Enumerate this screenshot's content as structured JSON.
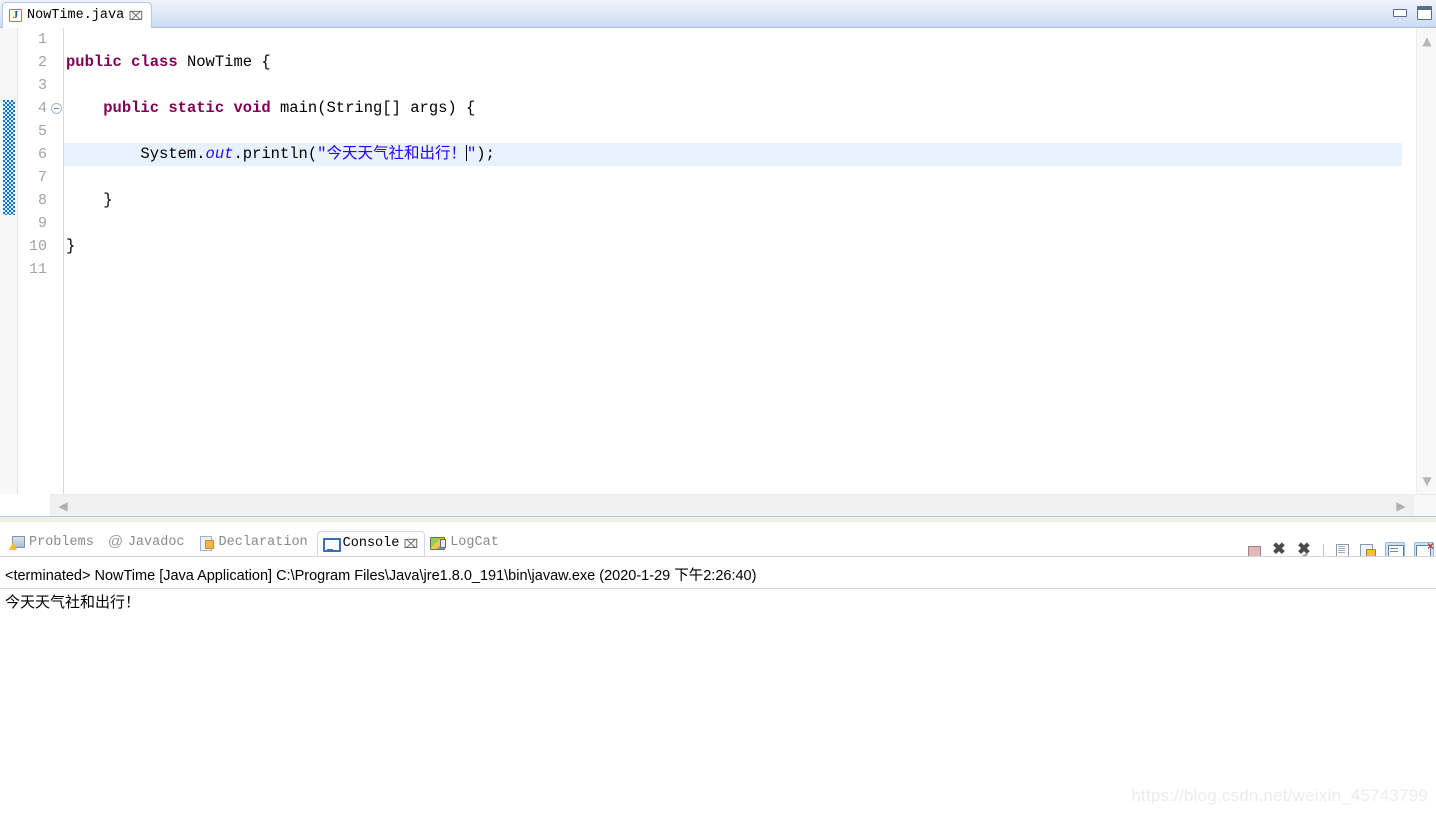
{
  "window": {
    "minimize_label": "Minimize",
    "maximize_label": "Maximize"
  },
  "editor": {
    "tab": {
      "label": "NowTime.java",
      "icon": "java-file-icon",
      "close_label": "⌧"
    },
    "line_numbers": [
      "1",
      "2",
      "3",
      "4",
      "5",
      "6",
      "7",
      "8",
      "9",
      "10",
      "11"
    ],
    "highlighted_line": 6,
    "folding_marker_line": 4,
    "lines": [
      {
        "n": "1",
        "segments": []
      },
      {
        "n": "2",
        "segments": [
          {
            "t": "public",
            "c": "kw"
          },
          {
            "t": " ",
            "c": ""
          },
          {
            "t": "class",
            "c": "kw"
          },
          {
            "t": " NowTime {",
            "c": ""
          }
        ]
      },
      {
        "n": "3",
        "segments": []
      },
      {
        "n": "4",
        "segments": [
          {
            "t": "    ",
            "c": ""
          },
          {
            "t": "public",
            "c": "kw"
          },
          {
            "t": " ",
            "c": ""
          },
          {
            "t": "static",
            "c": "kw"
          },
          {
            "t": " ",
            "c": ""
          },
          {
            "t": "void",
            "c": "kw"
          },
          {
            "t": " main(String[] args) {",
            "c": ""
          }
        ]
      },
      {
        "n": "5",
        "segments": []
      },
      {
        "n": "6",
        "segments": [
          {
            "t": "        System.",
            "c": ""
          },
          {
            "t": "out",
            "c": "fld"
          },
          {
            "t": ".println(",
            "c": ""
          },
          {
            "t": "\"今天天气社和出行！",
            "c": "str"
          },
          {
            "t": "CARET",
            "c": "caret"
          },
          {
            "t": "\"",
            "c": "str"
          },
          {
            "t": ");",
            "c": ""
          }
        ]
      },
      {
        "n": "7",
        "segments": []
      },
      {
        "n": "8",
        "segments": [
          {
            "t": "    }",
            "c": ""
          }
        ]
      },
      {
        "n": "9",
        "segments": []
      },
      {
        "n": "10",
        "segments": [
          {
            "t": "}",
            "c": ""
          }
        ]
      },
      {
        "n": "11",
        "segments": []
      }
    ],
    "scroll": {
      "up_arrow": "▲",
      "down_arrow": "▼",
      "left_arrow": "◀",
      "right_arrow": "▶"
    }
  },
  "console_panel": {
    "tabs": [
      {
        "label": "Problems",
        "icon": "problems-icon",
        "active": false,
        "closeable": false
      },
      {
        "label": "Javadoc",
        "icon": "javadoc-icon",
        "active": false,
        "closeable": false
      },
      {
        "label": "Declaration",
        "icon": "declaration-icon",
        "active": false,
        "closeable": false
      },
      {
        "label": "Console",
        "icon": "console-icon",
        "active": true,
        "closeable": true
      },
      {
        "label": "LogCat",
        "icon": "logcat-icon",
        "active": false,
        "closeable": false
      }
    ],
    "active_tab_close": "⌧",
    "toolbar": [
      {
        "name": "terminate-button",
        "icon": "stop-square-icon"
      },
      {
        "name": "remove-launch-button",
        "icon": "remove-x-icon"
      },
      {
        "name": "remove-all-terminated-button",
        "icon": "remove-all-x-icon"
      },
      {
        "name": "separator",
        "icon": "separator"
      },
      {
        "name": "clear-console-button",
        "icon": "clear-console-icon"
      },
      {
        "name": "scroll-lock-button",
        "icon": "scroll-lock-icon"
      },
      {
        "name": "pin-console-button",
        "icon": "display-console-icon"
      },
      {
        "name": "open-console-button",
        "icon": "display-console-close-icon"
      }
    ],
    "header_line": "<terminated> NowTime [Java Application] C:\\Program Files\\Java\\jre1.8.0_191\\bin\\javaw.exe (2020-1-29 下午2:26:40)",
    "output_lines": [
      "今天天气社和出行！"
    ]
  },
  "watermark": {
    "text": "https://blog.csdn.net/weixin_45743799"
  },
  "colors": {
    "keyword": "#7f0055",
    "string": "#2a00ff",
    "field": "#2a00ff",
    "line_highlight": "#e8f2fe",
    "change_bar": "#1076d0",
    "line_number": "#a3a3a3"
  }
}
